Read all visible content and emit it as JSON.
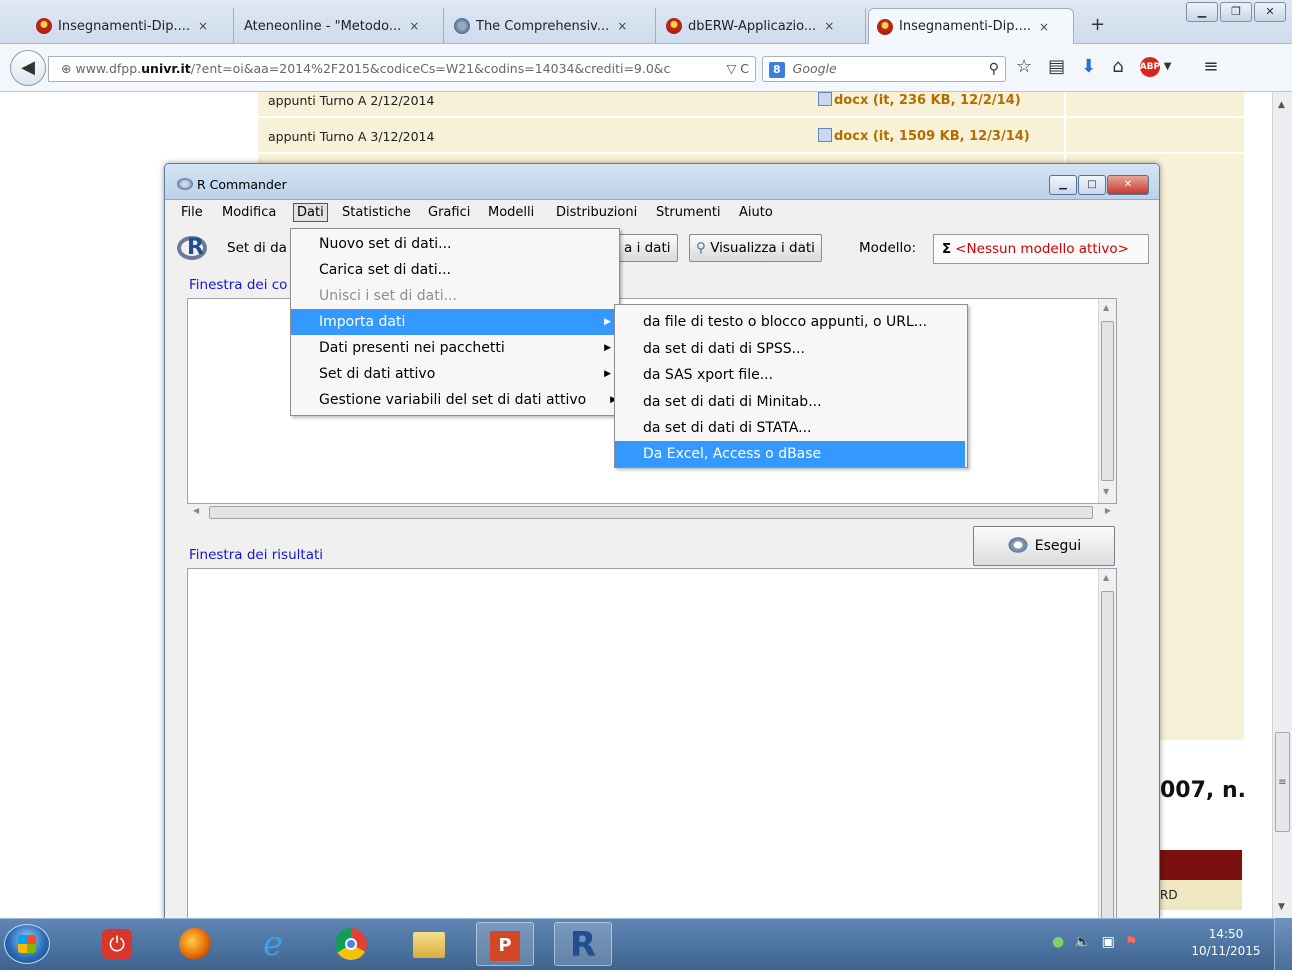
{
  "browser": {
    "tabs": [
      {
        "label": "Insegnamenti-Dip....",
        "close": "×"
      },
      {
        "label": "Ateneonline - \"Metodo...",
        "close": "×"
      },
      {
        "label": "The Comprehensiv...",
        "close": "×"
      },
      {
        "label": "dbERW-Applicazio...",
        "close": "×"
      },
      {
        "label": "Insegnamenti-Dip....",
        "close": "×"
      }
    ],
    "new_tab": "+",
    "url_host_pre": "www.dfpp.",
    "url_host_bold": "univr.it",
    "url_rest": "/?ent=oi&aa=2014%2F2015&codiceCs=W21&codins=14034&crediti=9.0&c",
    "url_controls": "▽ C",
    "search_engine": "8",
    "search_placeholder": "Google"
  },
  "webpage": {
    "rows": [
      {
        "text": "appunti Turno A 2/12/2014",
        "doc": "docx (it, 236 KB, 12/2/14)"
      },
      {
        "text": "appunti Turno A 3/12/2014",
        "doc": "docx (it, 1509 KB, 12/3/14)"
      }
    ],
    "partial_heading": "007, n.",
    "partial_cell": "RD"
  },
  "rcmdr": {
    "title": "R Commander",
    "menubar": [
      "File",
      "Modifica",
      "Dati",
      "Statistiche",
      "Grafici",
      "Modelli",
      "Distribuzioni",
      "Strumenti",
      "Aiuto"
    ],
    "dataset_label": "Set di da",
    "edit_btn_partial": "a i dati",
    "view_btn": "Visualizza i dati",
    "model_label": "Modello:",
    "model_sigma": "Σ",
    "model_value": "<Nessun modello attivo>",
    "script_label": "Finestra dei co",
    "output_label": "Finestra dei risultati",
    "run_button": "Esegui"
  },
  "dati_menu": [
    {
      "label": "Nuovo set di dati...",
      "state": "normal"
    },
    {
      "label": "Carica set di dati...",
      "state": "normal"
    },
    {
      "label": "Unisci i set di dati...",
      "state": "disabled"
    },
    {
      "label": "Importa dati",
      "state": "selected"
    },
    {
      "label": "Dati presenti nei pacchetti",
      "state": "normal"
    },
    {
      "label": "Set di dati attivo",
      "state": "normal"
    },
    {
      "label": "Gestione variabili del set di dati attivo",
      "state": "normal"
    }
  ],
  "importa_submenu": [
    {
      "label": "da file di testo o blocco appunti, o URL...",
      "state": "normal"
    },
    {
      "label": "da set di dati di SPSS...",
      "state": "normal"
    },
    {
      "label": "da SAS xport file...",
      "state": "normal"
    },
    {
      "label": "da set di dati di Minitab...",
      "state": "normal"
    },
    {
      "label": "da set di dati di STATA...",
      "state": "normal"
    },
    {
      "label": "Da Excel, Access o dBase",
      "state": "selected"
    }
  ],
  "taskbar": {
    "time": "14:50",
    "date": "10/11/2015"
  }
}
